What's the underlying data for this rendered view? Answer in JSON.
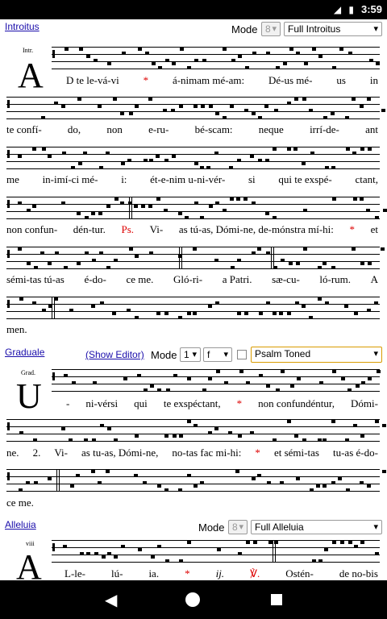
{
  "status_bar": {
    "icons": "◢ ▮",
    "time": "3:59"
  },
  "introitus": {
    "link": "Introitus",
    "mode_label": "Mode",
    "mode_value": "8",
    "type_value": "Full Introitus",
    "initial": "A",
    "anno": "Intr.",
    "lines": [
      [
        "D te le-vá-vi",
        "*",
        "á-nimam mé-am:",
        "Dé-us mé-",
        "us",
        "in"
      ],
      [
        "te confí-",
        "do,",
        "non",
        "e-ru-",
        "bé-scam:",
        "neque",
        "irrí-de-",
        "ant"
      ],
      [
        "me",
        "in-imí-ci mé-",
        "i:",
        "ét-e-nim u-ni-vér-",
        "si",
        "qui te exspé-",
        "ctant,"
      ],
      [
        "non confun-",
        "dén-tur.",
        "Ps.",
        "Vi-",
        "as tú-as, Dómi-ne, de-mónstra mí-hi:",
        "*",
        "et"
      ],
      [
        "sémi-tas tú-as",
        "é-do-",
        "ce me.",
        "Gló-ri-",
        "a Patri.",
        "sæ-cu-",
        "ló-rum.",
        "A"
      ],
      [
        "men."
      ]
    ]
  },
  "graduale": {
    "link": "Graduale",
    "show_editor": "(Show Editor)",
    "mode_label": "Mode",
    "mode_value": "1",
    "key_value": "f",
    "psalm_value": "Psalm Toned",
    "initial": "U",
    "anno": "Grad.",
    "lines": [
      [
        "-",
        "ni-vérsi",
        "qui",
        "te exspéctant,",
        "*",
        "non confundéntur,",
        "Dómi-"
      ],
      [
        "ne.",
        "2.",
        "Vi-",
        "as tu-as, Dómi-ne,",
        "no-tas fac mi-hi:",
        "*",
        "et sémi-tas",
        "tu-as é-do-"
      ],
      [
        "ce me."
      ]
    ]
  },
  "alleluia": {
    "link": "Alleluia",
    "mode_label": "Mode",
    "mode_value": "8",
    "type_value": "Full Alleluia",
    "initial": "A",
    "anno": "viii",
    "lines": [
      [
        "L-le-",
        "lú-",
        "ia.",
        "*",
        "ij.",
        "℣.",
        "Ostén-",
        "de no-bis"
      ]
    ]
  }
}
